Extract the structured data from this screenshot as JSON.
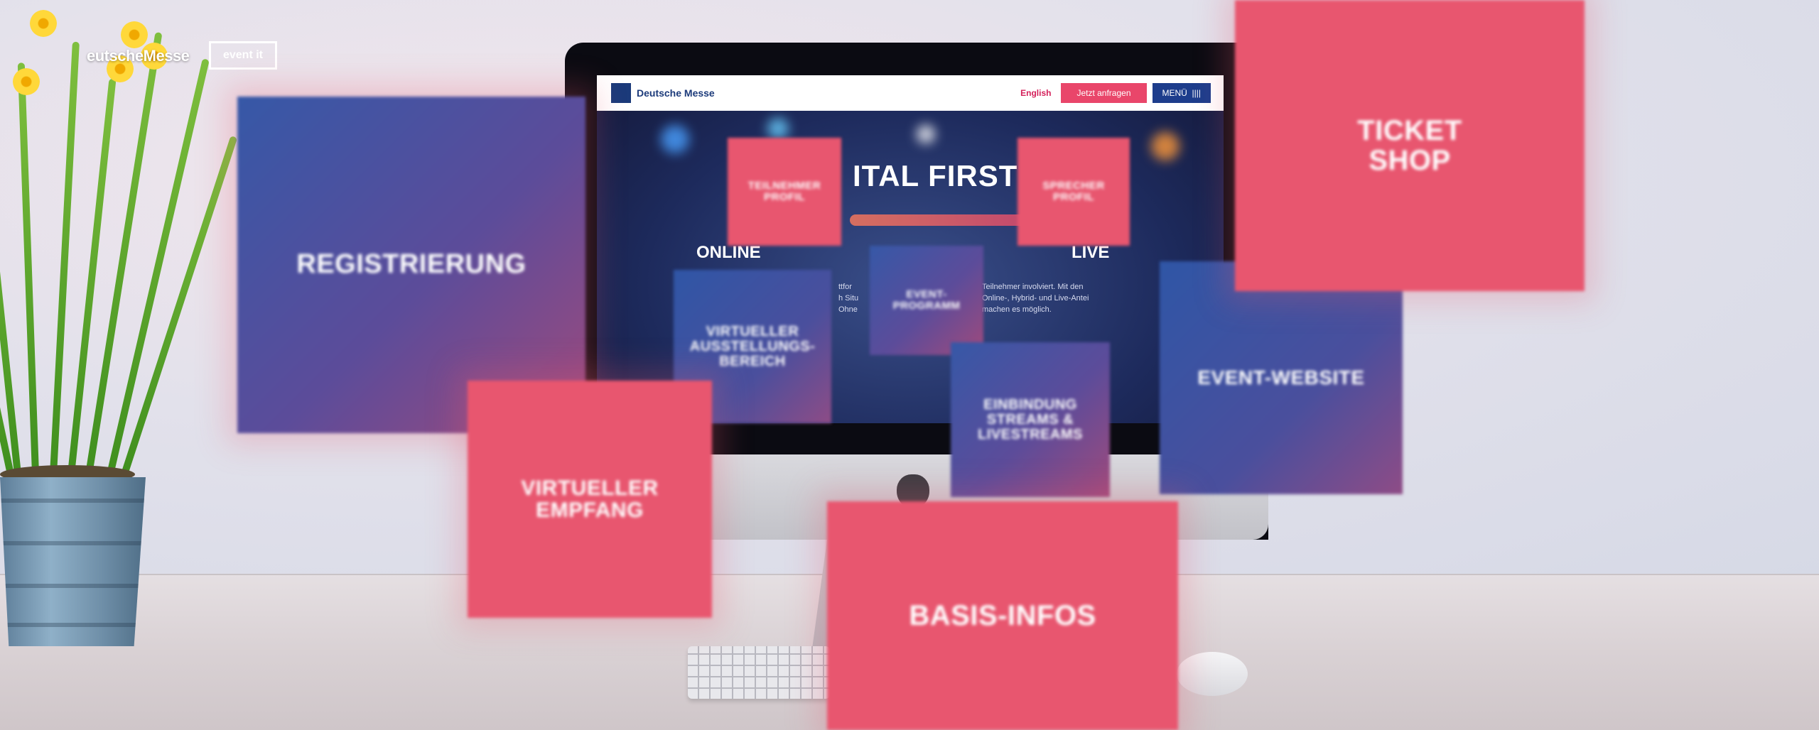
{
  "logos": {
    "deutsche_messe": "eutscheMesse",
    "event_it": "event it"
  },
  "website": {
    "brand": "Deutsche Messe",
    "lang_link": "English",
    "cta_button": "Jetzt anfragen",
    "menu_button": "MENÜ",
    "hero_title": "ITAL FIRST",
    "label_left": "ONLINE",
    "label_right": "LIVE",
    "text_left": [
      "ttfor",
      "h Situ",
      "Ohne"
    ],
    "text_right": [
      "Teilnehmer involviert. Mit den",
      "Online-, Hybrid- und Live-Antei",
      "machen es möglich."
    ]
  },
  "tiles": {
    "registrierung": "Registrierung",
    "teilnehmer_profil": [
      "Teilnehmer",
      "Profil"
    ],
    "sprecher_profil": [
      "Sprecher",
      "Profil"
    ],
    "event_programm": [
      "Event-",
      "Programm"
    ],
    "virtueller_ausstellungsbereich": [
      "Virtueller",
      "Ausstellungs-",
      "Bereich"
    ],
    "einbindung": [
      "Einbindung",
      "Streams &",
      "Livestreams"
    ],
    "event_website": "Event-Website",
    "ticket_shop": [
      "Ticket",
      "Shop"
    ],
    "virtueller_empfang": [
      "Virtueller",
      "Empfang"
    ],
    "basis_infos": "Basis-Infos"
  },
  "colors": {
    "tile_pink": "#e8566f",
    "tile_blue": "#3658a7",
    "nav_blue": "#1d3d8c",
    "cta_pink": "#e9466a"
  }
}
